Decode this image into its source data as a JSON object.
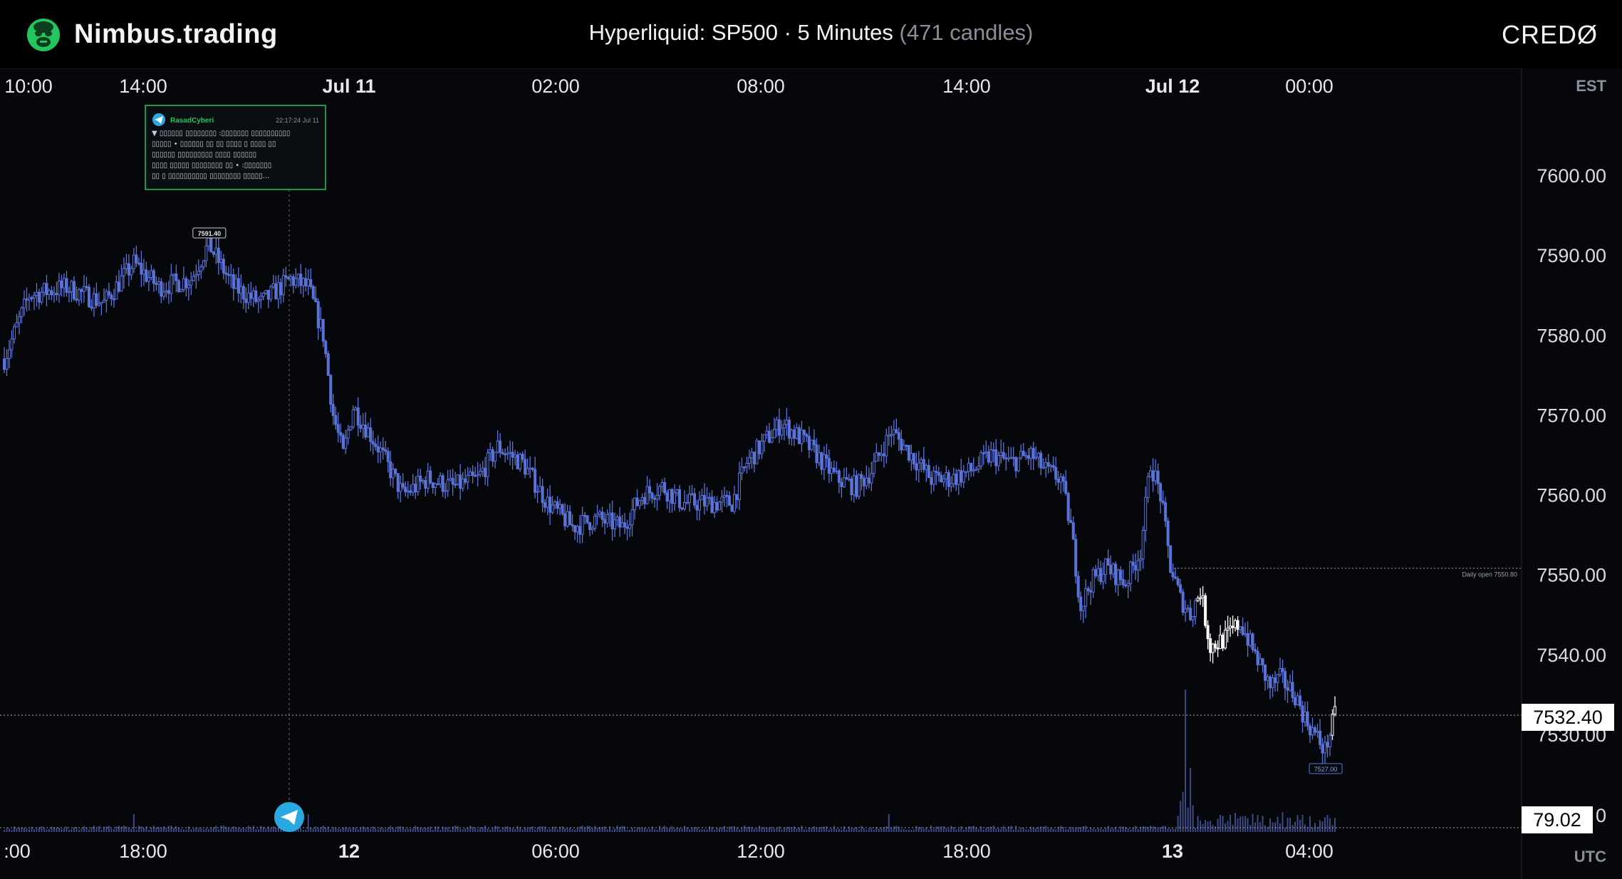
{
  "header": {
    "brand": "Nimbus.trading",
    "title_main": "Hyperliquid: SP500 · 5 Minutes",
    "title_muted": "(471 candles)",
    "right_logo": "CREDØ",
    "logo_icon": "gorilla-icon"
  },
  "colors": {
    "background": "#05070b",
    "candle": "#5a73d8",
    "candle_highlight": "#ffffff",
    "accent_green": "#22c55e",
    "telegram": "#2aa9e0"
  },
  "chart_data": {
    "type": "candlestick",
    "title": "Hyperliquid: SP500 · 5 Minutes",
    "candle_count": 471,
    "y_range": [
      7518,
      7610
    ],
    "y_ticks": [
      7600,
      7590,
      7580,
      7570,
      7560,
      7550,
      7540,
      7530
    ],
    "y_tick_labels": [
      "7600.00",
      "7590.00",
      "7580.00",
      "7570.00",
      "7560.00",
      "7550.00",
      "7540.00",
      "7530.00"
    ],
    "top_axis": {
      "timezone": "EST",
      "ticks": [
        {
          "label": "10:00",
          "bold": false
        },
        {
          "label": "14:00",
          "bold": false
        },
        {
          "label": "Jul 11",
          "bold": true
        },
        {
          "label": "02:00",
          "bold": false
        },
        {
          "label": "08:00",
          "bold": false
        },
        {
          "label": "14:00",
          "bold": false
        },
        {
          "label": "Jul 12",
          "bold": true
        },
        {
          "label": "00:00",
          "bold": false
        }
      ]
    },
    "bottom_axis": {
      "timezone": "UTC",
      "ticks": [
        {
          "label": ":00",
          "bold": false
        },
        {
          "label": "18:00",
          "bold": false
        },
        {
          "label": "12",
          "bold": true
        },
        {
          "label": "06:00",
          "bold": false
        },
        {
          "label": "12:00",
          "bold": false
        },
        {
          "label": "18:00",
          "bold": false
        },
        {
          "label": "13",
          "bold": true
        },
        {
          "label": "04:00",
          "bold": false
        }
      ]
    },
    "price_path": [
      [
        0,
        7577
      ],
      [
        10,
        7585
      ],
      [
        25,
        7586
      ],
      [
        40,
        7584
      ],
      [
        52,
        7589
      ],
      [
        62,
        7586
      ],
      [
        75,
        7587
      ],
      [
        82,
        7591.4
      ],
      [
        92,
        7586
      ],
      [
        103,
        7584
      ],
      [
        115,
        7587
      ],
      [
        122,
        7586
      ],
      [
        128,
        7580
      ],
      [
        132,
        7570
      ],
      [
        136,
        7565
      ],
      [
        140,
        7571
      ],
      [
        150,
        7566
      ],
      [
        160,
        7560
      ],
      [
        170,
        7562
      ],
      [
        180,
        7561
      ],
      [
        190,
        7562
      ],
      [
        198,
        7566
      ],
      [
        208,
        7564
      ],
      [
        218,
        7559
      ],
      [
        228,
        7556
      ],
      [
        238,
        7557
      ],
      [
        248,
        7556
      ],
      [
        256,
        7560
      ],
      [
        264,
        7561
      ],
      [
        272,
        7559
      ],
      [
        282,
        7559
      ],
      [
        292,
        7559
      ],
      [
        298,
        7564
      ],
      [
        306,
        7567
      ],
      [
        312,
        7569
      ],
      [
        320,
        7567
      ],
      [
        326,
        7565
      ],
      [
        334,
        7562
      ],
      [
        342,
        7561
      ],
      [
        348,
        7563
      ],
      [
        356,
        7568
      ],
      [
        364,
        7565
      ],
      [
        372,
        7562
      ],
      [
        380,
        7562
      ],
      [
        388,
        7563
      ],
      [
        396,
        7565
      ],
      [
        404,
        7564
      ],
      [
        412,
        7565
      ],
      [
        418,
        7563
      ],
      [
        424,
        7562
      ],
      [
        428,
        7556
      ],
      [
        432,
        7546
      ],
      [
        436,
        7549
      ],
      [
        442,
        7551
      ],
      [
        450,
        7549
      ],
      [
        456,
        7553
      ],
      [
        460,
        7564
      ],
      [
        464,
        7560
      ],
      [
        468,
        7551
      ],
      [
        472,
        7547
      ],
      [
        476,
        7545
      ],
      [
        480,
        7548
      ],
      [
        484,
        7541
      ],
      [
        490,
        7542
      ],
      [
        496,
        7544
      ],
      [
        502,
        7540
      ],
      [
        508,
        7536
      ],
      [
        512,
        7537
      ],
      [
        518,
        7535
      ],
      [
        522,
        7532
      ],
      [
        526,
        7530
      ],
      [
        530,
        7528
      ],
      [
        534,
        7532.4
      ]
    ],
    "total_candles_index": 540,
    "last_price": "7532.40",
    "last_price_value": 7532.4,
    "volume_last": "79.02",
    "volume_axis_label": "0",
    "daily_open_label": "Daily open 7550.80",
    "daily_open_value": 7550.8,
    "high_marker": {
      "label": "7591.40",
      "value": 7591.4
    },
    "low_marker": {
      "label": "7527.00",
      "value": 7527.0
    },
    "telegram_card": {
      "author": "RasadCyberi",
      "time": "22:17:24 Jul 11",
      "lines": [
        "▼ ▯▯▯▯▯▯ ▯▯▯▯▯▯▯▯ :▯▯▯▯▯▯▯ ▯▯▯▯▯▯▯▯▯▯",
        "▯▯▯▯▯ • ▯▯▯▯▯▯ ▯▯ ▯▯ ▯▯▯▯ ▯ ▯▯▯▯ ▯▯",
        "▯▯▯▯▯▯ ▯▯▯▯▯▯▯▯▯ ▯▯▯▯ ▯▯▯▯▯▯",
        "▯▯▯▯ ▯▯▯▯▯ ▯▯▯▯▯▯▯▯ ▯▯ • :▯▯▯▯▯▯▯",
        "▯▯ ▯ ▯▯▯▯▯▯▯▯▯▯ ▯▯▯▯▯▯▯▯ ▯▯▯▯▯..."
      ]
    }
  }
}
